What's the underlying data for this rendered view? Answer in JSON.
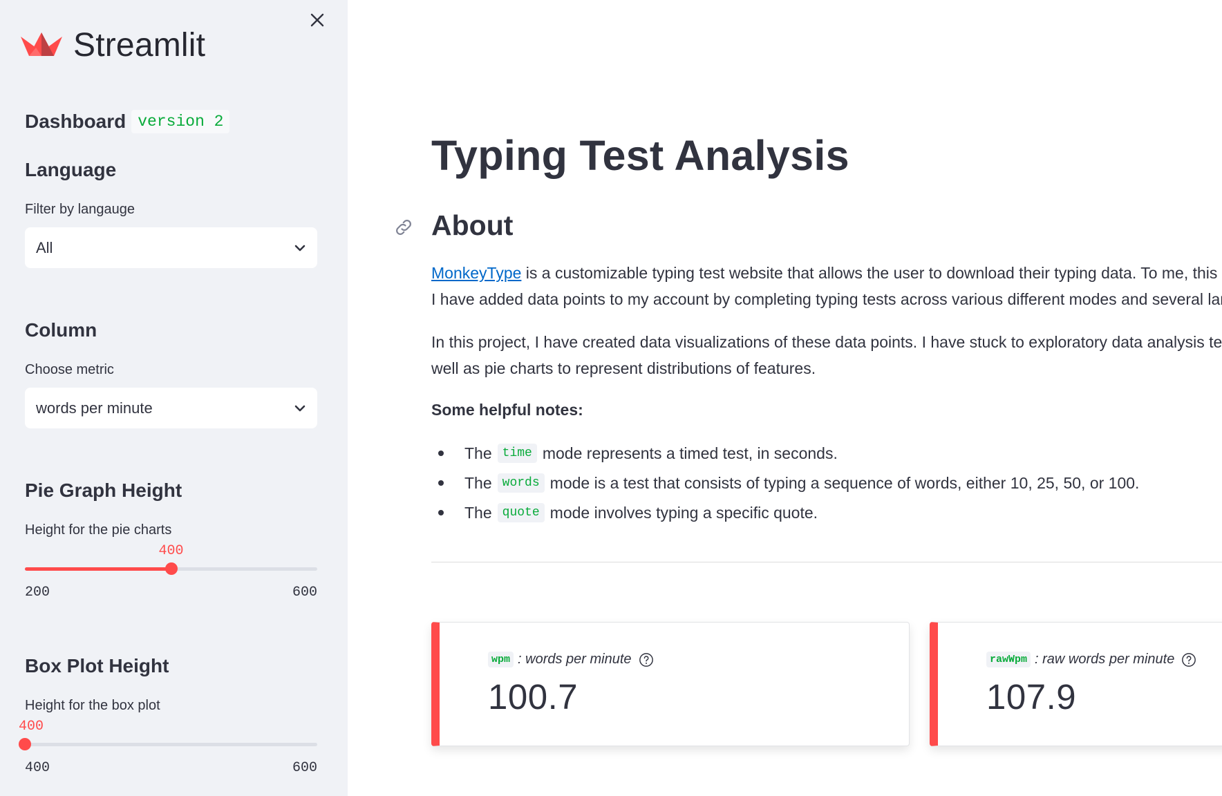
{
  "sidebar": {
    "brand": "Streamlit",
    "dashboard": {
      "title": "Dashboard",
      "badge": "version 2"
    },
    "language": {
      "heading": "Language",
      "label": "Filter by langauge",
      "selected": "All"
    },
    "column": {
      "heading": "Column",
      "label": "Choose metric",
      "selected": "words per minute"
    },
    "pie_height": {
      "heading": "Pie Graph Height",
      "label": "Height for the pie charts",
      "value": "400",
      "min": "200",
      "max": "600",
      "fraction": 0.5
    },
    "box_height": {
      "heading": "Box Plot Height",
      "label": "Height for the box plot",
      "value": "400",
      "min": "400",
      "max": "600",
      "fraction": 0.0
    }
  },
  "main": {
    "title": "Typing Test Analysis",
    "about": {
      "heading": "About",
      "p1_link": "MonkeyType",
      "p1_line1_rest": " is a customizable typing test website that allows the user to download their typing data. To me, this pr",
      "p1_line2": "I have added data points to my account by completing typing tests across various different modes and several langu",
      "p2_line1": "In this project, I have created data visualizations of these data points. I have stuck to exploratory data analysis techn",
      "p2_line2": "well as pie charts to represent distributions of features."
    },
    "notes": {
      "heading": "Some helpful notes:",
      "items": [
        {
          "prefix": "The",
          "code": "time",
          "suffix": "mode represents a timed test, in seconds."
        },
        {
          "prefix": "The",
          "code": "words",
          "suffix": "mode is a test that consists of typing a sequence of words, either 10, 25, 50, or 100."
        },
        {
          "prefix": "The",
          "code": "quote",
          "suffix": "mode involves typing a specific quote."
        }
      ]
    },
    "metrics": [
      {
        "code": "wpm",
        "label": ": words per minute",
        "value": "100.7"
      },
      {
        "code": "rawWpm",
        "label": ": raw words per minute",
        "value": "107.9"
      }
    ]
  },
  "colors": {
    "accent": "#ff4b4b",
    "code_green": "#09ab3b",
    "link_blue": "#0068c9",
    "sidebar_bg": "#f0f2f6",
    "text": "#31333f"
  },
  "icons": {
    "close": "close-icon",
    "logo": "streamlit-logo-icon",
    "chevron": "chevron-down-icon",
    "link": "link-icon",
    "help": "help-icon"
  }
}
